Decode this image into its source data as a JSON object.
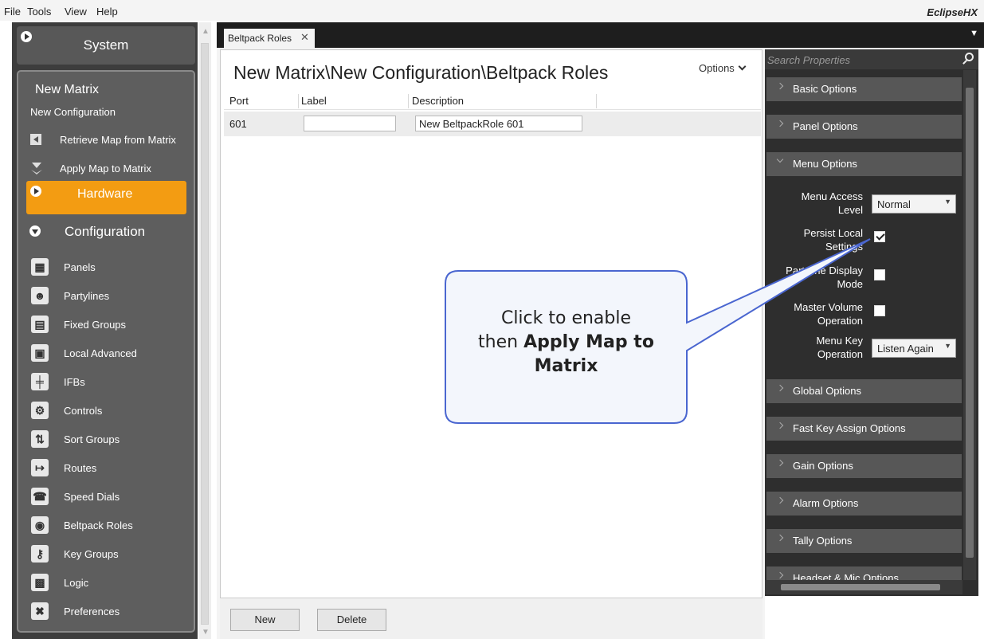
{
  "menubar": {
    "items": [
      "File",
      "Tools",
      "View",
      "Help"
    ],
    "brand": "EclipseHX"
  },
  "sidebar": {
    "system_label": "System",
    "matrix_title": "New Matrix",
    "config_subtitle": "New Configuration",
    "actions": [
      {
        "label": "Retrieve Map from Matrix",
        "icon": "retrieve-map-icon"
      },
      {
        "label": "Apply Map to Matrix",
        "icon": "apply-map-icon"
      }
    ],
    "hardware_label": "Hardware",
    "configuration_label": "Configuration",
    "items": [
      {
        "label": "Panels",
        "icon": "panels-icon"
      },
      {
        "label": "Partylines",
        "icon": "partylines-icon"
      },
      {
        "label": "Fixed Groups",
        "icon": "fixed-groups-icon"
      },
      {
        "label": "Local Advanced",
        "icon": "local-advanced-icon"
      },
      {
        "label": "IFBs",
        "icon": "ifbs-icon"
      },
      {
        "label": "Controls",
        "icon": "controls-icon"
      },
      {
        "label": "Sort Groups",
        "icon": "sort-groups-icon"
      },
      {
        "label": "Routes",
        "icon": "routes-icon"
      },
      {
        "label": "Speed Dials",
        "icon": "speed-dials-icon"
      },
      {
        "label": "Beltpack Roles",
        "icon": "beltpack-roles-icon"
      },
      {
        "label": "Key Groups",
        "icon": "key-groups-icon"
      },
      {
        "label": "Logic",
        "icon": "logic-icon"
      },
      {
        "label": "Preferences",
        "icon": "preferences-icon"
      }
    ]
  },
  "tab": {
    "label": "Beltpack Roles"
  },
  "main": {
    "title": "New Matrix\\New Configuration\\Beltpack Roles",
    "options_label": "Options",
    "columns": [
      "Port",
      "Label",
      "Description"
    ],
    "rows": [
      {
        "port": "601",
        "label": "",
        "description": "New BeltpackRole 601"
      }
    ],
    "new_button": "New",
    "delete_button": "Delete"
  },
  "properties": {
    "search_placeholder": "Search Properties",
    "sections_before": [
      "Basic Options",
      "Panel Options"
    ],
    "menu_section": "Menu Options",
    "menu_access_level": {
      "label": "Menu Access Level",
      "value": "Normal"
    },
    "persist_local_settings": {
      "label": "Persist Local Settings",
      "checked": true
    },
    "partyline_display_mode": {
      "label": "Partyline Display Mode",
      "checked": false
    },
    "master_volume_operation": {
      "label": "Master Volume Operation",
      "checked": false
    },
    "menu_key_operation": {
      "label": "Menu Key Operation",
      "value": "Listen Again"
    },
    "sections_after": [
      "Global Options",
      "Fast Key Assign Options",
      "Gain Options",
      "Alarm Options",
      "Tally Options",
      "Headset & Mic Options"
    ]
  },
  "callout": {
    "line1": "Click to enable",
    "line2_prefix": "then ",
    "line2_bold": "Apply Map to",
    "line3_bold": "Matrix"
  },
  "colors": {
    "accent": "#f39c12",
    "sidebar_bg": "#3d3d3d",
    "props_bg": "#2e2e2e",
    "callout_border": "#4a66d0"
  }
}
